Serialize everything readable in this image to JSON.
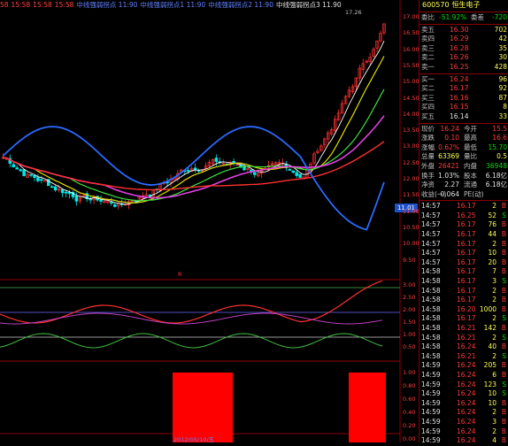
{
  "top_bar": [
    {
      "text": "58",
      "color": "#ff4040"
    },
    {
      "text": "15:58",
      "color": "#ff4040"
    },
    {
      "text": "15:58",
      "color": "#ff4040"
    },
    {
      "text": "15:58",
      "color": "#ff4040"
    },
    {
      "text": "中线强弱拐点 11:90",
      "color": "#6080ff"
    },
    {
      "text": "中线强弱拐点1 11:90",
      "color": "#6080ff"
    },
    {
      "text": "中线强弱拐点2 11:90",
      "color": "#6080ff"
    },
    {
      "text": "中线强弱拐点3 11.90",
      "color": "#e0e0e0"
    }
  ],
  "chart_labels": {
    "peak": "17.26",
    "price_tag": "11.01",
    "date": "2012/05/10/五",
    "marker": "R"
  },
  "price_axis": [
    "17.00",
    "16.50",
    "16.00",
    "15.50",
    "15.00",
    "14.50",
    "14.00",
    "13.50",
    "13.00",
    "12.50",
    "12.00",
    "11.50",
    "11.00",
    "10.50",
    "10.00",
    "9.50"
  ],
  "ind1_axis": [
    "3.00",
    "2.50",
    "2.00",
    "1.50",
    "1.00",
    "0.50"
  ],
  "ind2_axis": [
    "1.00",
    "0.80",
    "0.60",
    "0.40",
    "0.20",
    "0.00"
  ],
  "stock": {
    "code": "600570",
    "name": "恒生电子"
  },
  "ratio": {
    "label1": "委比",
    "value1": "-51.92%",
    "label2": "委差",
    "value2": "-720"
  },
  "asks": [
    {
      "label": "卖五",
      "price": "16.30",
      "vol": "702"
    },
    {
      "label": "卖四",
      "price": "16.29",
      "vol": "42"
    },
    {
      "label": "卖三",
      "price": "16.28",
      "vol": "35"
    },
    {
      "label": "卖二",
      "price": "16.26",
      "vol": "30"
    },
    {
      "label": "卖一",
      "price": "16.25",
      "vol": "428"
    }
  ],
  "bids": [
    {
      "label": "买一",
      "price": "16.24",
      "vol": "96"
    },
    {
      "label": "买二",
      "price": "16.17",
      "vol": "92"
    },
    {
      "label": "买三",
      "price": "16.16",
      "vol": "87"
    },
    {
      "label": "买四",
      "price": "16.15",
      "vol": "8"
    },
    {
      "label": "买五",
      "price": "16.14",
      "vol": "33"
    }
  ],
  "stats": [
    {
      "l1": "现价",
      "v1": "16.24",
      "c1": "red",
      "l2": "今开",
      "v2": "15.5",
      "c2": "red"
    },
    {
      "l1": "涨跌",
      "v1": "0.10",
      "c1": "red",
      "l2": "最高",
      "v2": "16.6",
      "c2": "red"
    },
    {
      "l1": "涨幅",
      "v1": "0.62%",
      "c1": "red",
      "l2": "最低",
      "v2": "15.70",
      "c2": "grn"
    },
    {
      "l1": "总量",
      "v1": "63369",
      "c1": "yel",
      "l2": "量比",
      "v2": "0.5",
      "c2": "yel"
    },
    {
      "l1": "外盘",
      "v1": "26421",
      "c1": "red",
      "l2": "内盘",
      "v2": "36948",
      "c2": "grn"
    },
    {
      "l1": "换手",
      "v1": "1.03%",
      "c1": "wht",
      "l2": "股本",
      "v2": "6.18亿",
      "c2": "wht"
    },
    {
      "l1": "净资",
      "v1": "2.27",
      "c1": "wht",
      "l2": "流通",
      "v2": "6.18亿",
      "c2": "wht"
    },
    {
      "l1": "收益(一)",
      "v1": "0.064",
      "c1": "wht",
      "l2": "PE(动)",
      "v2": "",
      "c2": "wht"
    }
  ],
  "ticks": [
    {
      "time": "14:57",
      "price": "16.17",
      "vol": "2",
      "dir": "B"
    },
    {
      "time": "14:57",
      "price": "16.25",
      "vol": "52",
      "dir": "S"
    },
    {
      "time": "14:57",
      "price": "16.17",
      "vol": "76",
      "dir": "B"
    },
    {
      "time": "14:57",
      "price": "16.17",
      "vol": "44",
      "dir": "B"
    },
    {
      "time": "14:57",
      "price": "16.17",
      "vol": "2",
      "dir": "B"
    },
    {
      "time": "14:57",
      "price": "16.17",
      "vol": "10",
      "dir": "B"
    },
    {
      "time": "14:57",
      "price": "16.17",
      "vol": "20",
      "dir": "B"
    },
    {
      "time": "14:58",
      "price": "16.17",
      "vol": "7",
      "dir": "B"
    },
    {
      "time": "14:58",
      "price": "16.17",
      "vol": "3",
      "dir": "S"
    },
    {
      "time": "14:58",
      "price": "16.17",
      "vol": "2",
      "dir": "B"
    },
    {
      "time": "14:58",
      "price": "16.17",
      "vol": "2",
      "dir": "B"
    },
    {
      "time": "14:58",
      "price": "16.20",
      "vol": "1000",
      "dir": "B"
    },
    {
      "time": "14:58",
      "price": "16.17",
      "vol": "2",
      "dir": "S"
    },
    {
      "time": "14:58",
      "price": "16.21",
      "vol": "142",
      "dir": "B"
    },
    {
      "time": "14:58",
      "price": "16.21",
      "vol": "2",
      "dir": "S"
    },
    {
      "time": "14:58",
      "price": "16.24",
      "vol": "40",
      "dir": "B"
    },
    {
      "time": "14:58",
      "price": "16.21",
      "vol": "2",
      "dir": "S"
    },
    {
      "time": "14:59",
      "price": "16.24",
      "vol": "205",
      "dir": "B"
    },
    {
      "time": "14:59",
      "price": "16.24",
      "vol": "6",
      "dir": "B"
    },
    {
      "time": "14:59",
      "price": "16.24",
      "vol": "123",
      "dir": "S"
    },
    {
      "time": "14:59",
      "price": "16.24",
      "vol": "10",
      "dir": "S"
    },
    {
      "time": "14:59",
      "price": "16.24",
      "vol": "10",
      "dir": "B"
    },
    {
      "time": "14:59",
      "price": "16.24",
      "vol": "2",
      "dir": "B"
    },
    {
      "time": "14:59",
      "price": "16.24",
      "vol": "3",
      "dir": "B"
    },
    {
      "time": "14:59",
      "price": "16.24",
      "vol": "2",
      "dir": "B"
    },
    {
      "time": "14:59",
      "price": "16.24",
      "vol": "4",
      "dir": "B"
    }
  ]
}
